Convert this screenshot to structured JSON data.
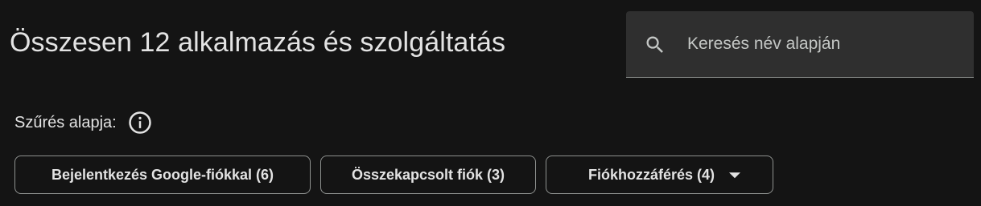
{
  "header": {
    "title": "Összesen 12 alkalmazás és szolgáltatás"
  },
  "search": {
    "placeholder": "Keresés név alapján",
    "value": "",
    "icon": "search-icon"
  },
  "filters": {
    "label": "Szűrés alapja:",
    "info_icon": "info-icon",
    "chips": [
      {
        "label": "Bejelentkezés Google-fiókkal (6)"
      },
      {
        "label": "Összekapcsolt fiók (3)"
      },
      {
        "label": "Fiókhozzáférés (4)",
        "icon": "dropdown-arrow-icon"
      }
    ]
  },
  "colors": {
    "background": "#141414",
    "text": "#e3e3e3",
    "search_field": "#2f2f2f",
    "outline": "#8e918f"
  }
}
